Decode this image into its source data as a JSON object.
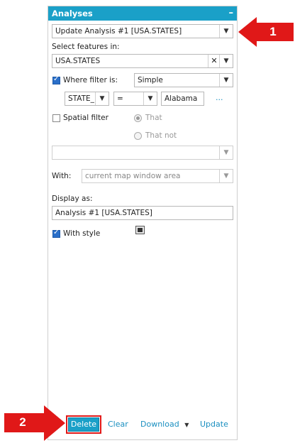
{
  "panel": {
    "title": "Analyses",
    "collapse_glyph": "–",
    "analysis_select": "Update Analysis #1 [USA.STATES]",
    "select_features_label": "Select features in:",
    "features_value": "USA.STATES",
    "where_filter_label": "Where filter is:",
    "filter_mode": "Simple",
    "filter_field": "STATE_",
    "filter_operator": "=",
    "filter_value": "Alabama",
    "filter_more": "...",
    "spatial_filter_label": "Spatial filter",
    "radio_that": "That",
    "radio_that_not": "That not",
    "spatial_select": "",
    "with_label": "With:",
    "with_value": "current map window area",
    "display_as_label": "Display as:",
    "display_as_value": "Analysis #1 [USA.STATES]",
    "with_style_label": "With style"
  },
  "footer": {
    "delete": "Delete",
    "clear": "Clear",
    "download": "Download",
    "download_caret": "▼",
    "update": "Update"
  },
  "callouts": {
    "one": "1",
    "two": "2"
  },
  "colors": {
    "accent": "#1aa0c8",
    "callout": "#e01818"
  }
}
